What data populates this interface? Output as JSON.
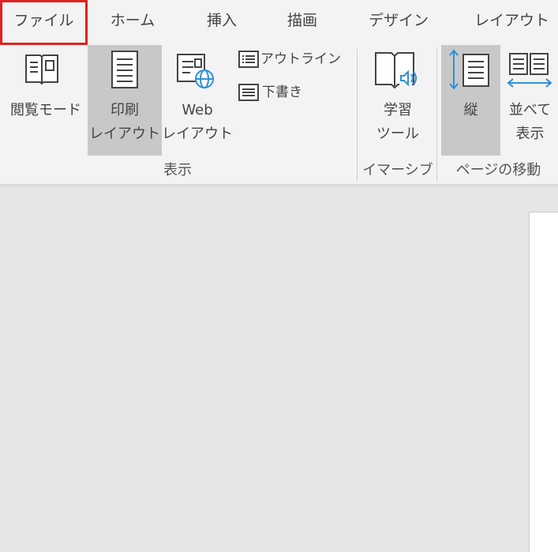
{
  "tabs": [
    {
      "label": "ファイル"
    },
    {
      "label": "ホーム"
    },
    {
      "label": "挿入"
    },
    {
      "label": "描画"
    },
    {
      "label": "デザイン"
    },
    {
      "label": "レイアウト"
    }
  ],
  "ribbon": {
    "read_mode": "閲覧モード",
    "print_layout_1": "印刷",
    "print_layout_2": "レイアウト",
    "web_layout_1": "Web",
    "web_layout_2": "レイアウト",
    "outline": "アウトライン",
    "draft": "下書き",
    "learning_tools_1": "学習",
    "learning_tools_2": "ツール",
    "vertical": "縦",
    "side_by_side_1": "並べて",
    "side_by_side_2": "表示",
    "groups": {
      "views": "表示",
      "immersive": "イマーシブ",
      "page_movement": "ページの移動"
    }
  },
  "colors": {
    "accent": "#2e8fd8",
    "highlight_border": "#e02020",
    "active_bg": "#c8c8c8"
  }
}
